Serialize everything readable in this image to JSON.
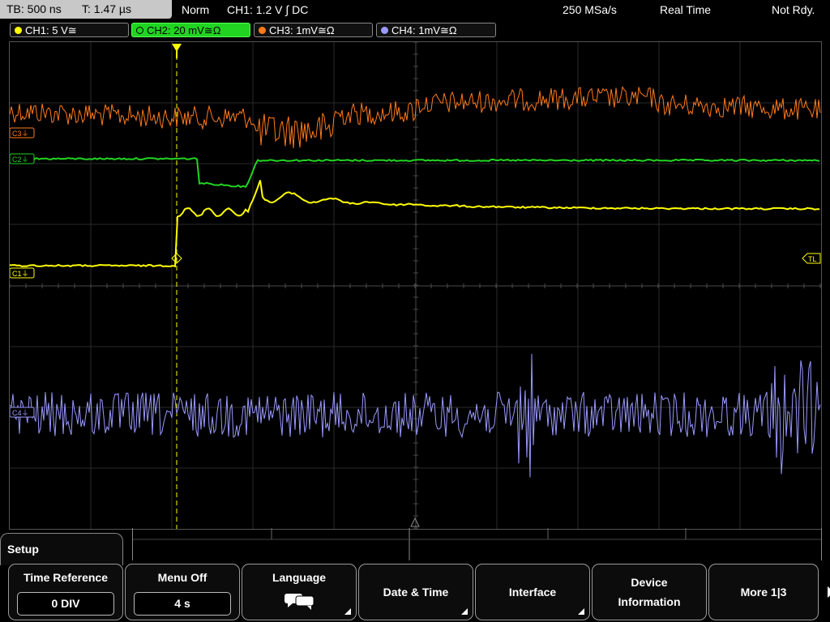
{
  "status": {
    "timebase": "TB: 500 ns",
    "trigger_time": "T: 1.47 µs",
    "mode": "Norm",
    "trigger": "CH1: 1.2 V ∫ DC",
    "sample_rate": "250 MSa/s",
    "acq_mode": "Real Time",
    "state": "Not Rdy."
  },
  "channels": [
    {
      "label": "CH1: 5 V≅",
      "color": "#ffff00"
    },
    {
      "label": "CH2: 20 mV≅Ω",
      "color": "#22d422"
    },
    {
      "label": "CH3: 1mV≅Ω",
      "color": "#ff7a1a"
    },
    {
      "label": "CH4: 1mV≅Ω",
      "color": "#9a99ff"
    }
  ],
  "markers": {
    "c3": "C3⏚",
    "c2": "C2⏚",
    "c1": "C1⏚",
    "c4": "C4⏚",
    "trigger_level": "TL"
  },
  "menu": {
    "title": "Setup",
    "time_reference": {
      "label": "Time Reference",
      "value": "0 DIV"
    },
    "menu_off": {
      "label": "Menu Off",
      "value": "4 s"
    },
    "language": {
      "label": "Language",
      "icon": "language-icon"
    },
    "date_time": {
      "label": "Date & Time"
    },
    "interface": {
      "label": "Interface"
    },
    "device_info": {
      "line1": "Device",
      "line2": "Information"
    },
    "more": {
      "label": "More 1|3"
    }
  }
}
